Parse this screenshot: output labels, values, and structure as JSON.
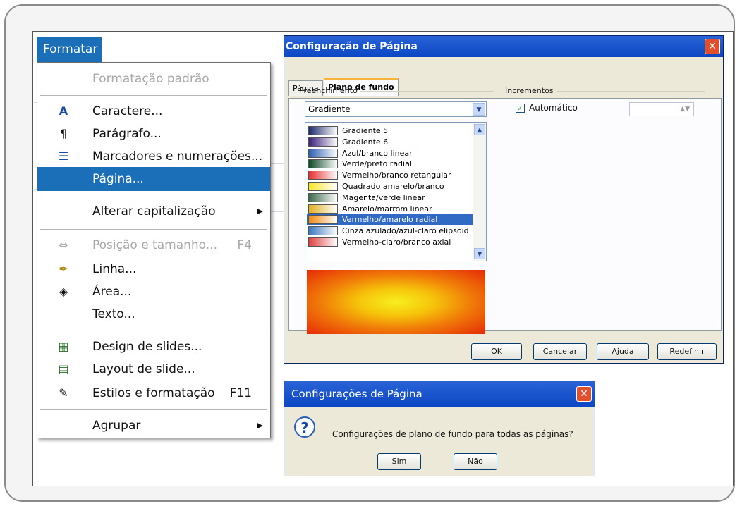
{
  "menu": {
    "title": "Formatar",
    "items": [
      {
        "label": "Formatação padrão",
        "shortcut": "",
        "icon": "none",
        "disabled": true
      },
      {
        "label": "Caractere...",
        "shortcut": "",
        "icon": "character-icon"
      },
      {
        "label": "Parágrafo...",
        "shortcut": "",
        "icon": "paragraph-icon"
      },
      {
        "label": "Marcadores e numerações...",
        "shortcut": "",
        "icon": "bullets-icon"
      },
      {
        "label": "Página...",
        "shortcut": "",
        "icon": "none",
        "selected": true
      },
      {
        "label": "Alterar capitalização",
        "shortcut": "",
        "icon": "none",
        "submenu": true
      },
      {
        "label": "Posição e tamanho...",
        "shortcut": "F4",
        "icon": "position-size-icon",
        "disabled": true
      },
      {
        "label": "Linha...",
        "shortcut": "",
        "icon": "line-icon"
      },
      {
        "label": "Área...",
        "shortcut": "",
        "icon": "area-icon"
      },
      {
        "label": "Texto...",
        "shortcut": "",
        "icon": "none"
      },
      {
        "label": "Design de slides...",
        "shortcut": "",
        "icon": "slide-design-icon"
      },
      {
        "label": "Layout de slide...",
        "shortcut": "",
        "icon": "slide-layout-icon"
      },
      {
        "label": "Estilos e formatação",
        "shortcut": "F11",
        "icon": "styles-icon"
      },
      {
        "label": "Agrupar",
        "shortcut": "",
        "icon": "none",
        "submenu": true
      }
    ]
  },
  "page_setup": {
    "title": "Configuração de Página",
    "tabs": [
      "Página",
      "Plano de fundo"
    ],
    "active_tab": "Plano de fundo",
    "fill_group_label": "Preenchimento",
    "fill_type": "Gradiente",
    "gradients": [
      {
        "name": "Gradiente 5",
        "color": "#1d2a6b"
      },
      {
        "name": "Gradiente 6",
        "color": "#3a1f7a"
      },
      {
        "name": "Azul/branco linear",
        "color": "#2b5fb0"
      },
      {
        "name": "Verde/preto radial",
        "color": "#0f4a26"
      },
      {
        "name": "Vermelho/branco retangular",
        "color": "#e63030"
      },
      {
        "name": "Quadrado amarelo/branco",
        "color": "#f5e52a"
      },
      {
        "name": "Magenta/verde linear",
        "color": "#3a6a4a"
      },
      {
        "name": "Amarelo/marrom linear",
        "color": "#e0b020"
      },
      {
        "name": "Vermelho/amarelo radial",
        "color": "#f08a10",
        "selected": true
      },
      {
        "name": "Cinza azulado/azul-claro elipsoid",
        "color": "#3a78c0"
      },
      {
        "name": "Vermelho-claro/branco axial",
        "color": "#e04040"
      }
    ],
    "increments_label": "Incrementos",
    "auto_label": "Automático",
    "auto_checked": true,
    "buttons": {
      "ok": "OK",
      "cancel": "Cancelar",
      "help": "Ajuda",
      "reset": "Redefinir"
    }
  },
  "confirm_dialog": {
    "title": "Configurações de Página",
    "message": "Configurações de plano de fundo para todas as páginas?",
    "yes": "Sim",
    "no": "Não"
  }
}
